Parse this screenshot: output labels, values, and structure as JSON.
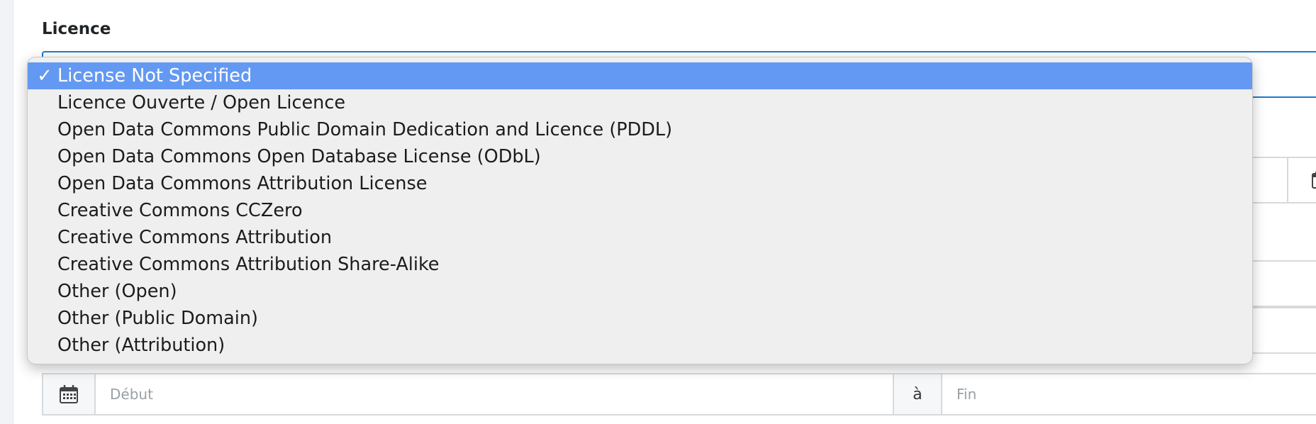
{
  "form": {
    "licence_label": "Licence",
    "licence_select": {
      "selected": "License Not Specified",
      "options": [
        "License Not Specified",
        "Licence Ouverte / Open Licence",
        "Open Data Commons Public Domain Dedication and Licence (PDDL)",
        "Open Data Commons Open Database License (ODbL)",
        "Open Data Commons Attribution License",
        "Creative Commons CCZero",
        "Creative Commons Attribution",
        "Creative Commons Attribution Share-Alike",
        "Other (Open)",
        "Other (Public Domain)",
        "Other (Attribution)"
      ]
    },
    "date_range": {
      "start_placeholder": "Début",
      "separator": "à",
      "end_placeholder": "Fin"
    }
  },
  "icons": {
    "checkmark": "✓",
    "calendar": "calendar-icon"
  },
  "colors": {
    "selection_highlight": "#6399f2",
    "focus_border": "#1f7ac7"
  }
}
